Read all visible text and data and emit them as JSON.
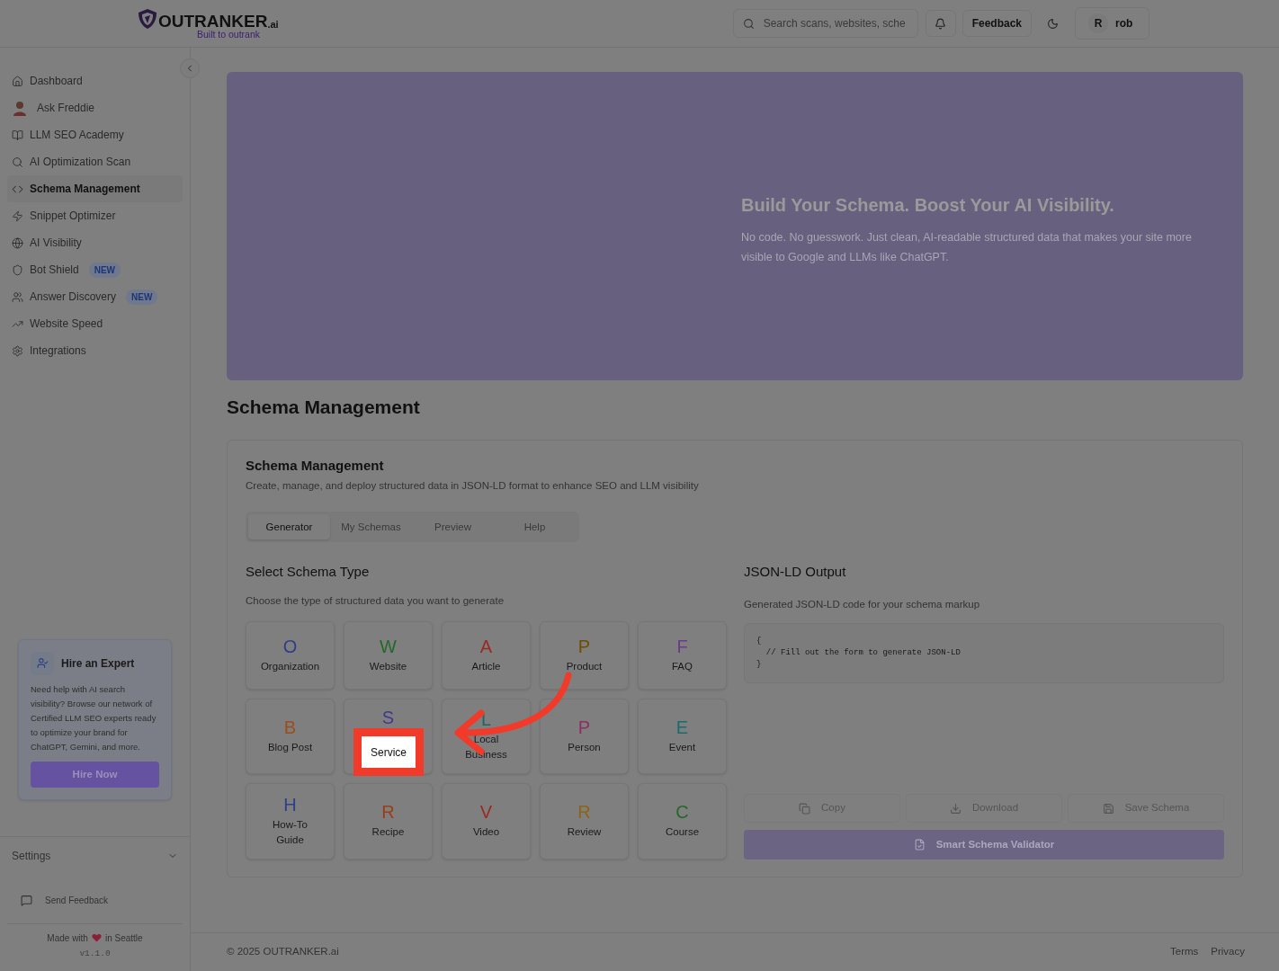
{
  "header": {
    "logo": {
      "name": "OUTRANKER",
      "suffix": ".ai",
      "tagline": "Built to outrank"
    },
    "search": {
      "placeholder": "Search scans, websites, sche"
    },
    "feedback_button": "Feedback",
    "user": {
      "initial": "R",
      "name": "rob"
    }
  },
  "sidebar": {
    "items": [
      {
        "label": "Dashboard",
        "selected": false,
        "kind": "icon"
      },
      {
        "label": "Ask Freddie",
        "selected": false,
        "kind": "avatar"
      },
      {
        "label": "LLM SEO Academy",
        "selected": false,
        "kind": "icon"
      },
      {
        "label": "AI Optimization Scan",
        "selected": false,
        "kind": "icon"
      },
      {
        "label": "Schema Management",
        "selected": true,
        "kind": "icon"
      },
      {
        "label": "Snippet Optimizer",
        "selected": false,
        "kind": "icon"
      },
      {
        "label": "AI Visibility",
        "selected": false,
        "kind": "icon"
      },
      {
        "label": "Bot Shield",
        "selected": false,
        "kind": "icon",
        "badge": "NEW"
      },
      {
        "label": "Answer Discovery",
        "selected": false,
        "kind": "icon",
        "badge": "NEW"
      },
      {
        "label": "Website Speed",
        "selected": false,
        "kind": "icon"
      },
      {
        "label": "Integrations",
        "selected": false,
        "kind": "icon"
      }
    ],
    "hire_card": {
      "title": "Hire an Expert",
      "text": "Need help with AI search visibility? Browse our network of Certified LLM SEO experts ready to optimize your brand for ChatGPT, Gemini, and more.",
      "button": "Hire Now"
    },
    "settings": {
      "label": "Settings",
      "expanded": false
    },
    "send_feedback": "Send Feedback",
    "made_with": {
      "before": "Made with",
      "after": "in Seattle",
      "version": "v1.1.0"
    }
  },
  "banner": {
    "title": "Build Your Schema. Boost Your AI Visibility.",
    "subtitle": "No code. No guesswork. Just clean, AI-readable structured data that makes your site more visible to Google and LLMs like ChatGPT."
  },
  "page_title": "Schema Management",
  "panel": {
    "title": "Schema Management",
    "description": "Create, manage, and deploy structured data in JSON-LD format to enhance SEO and LLM visibility",
    "tabs": [
      {
        "label": "Generator",
        "selected": true
      },
      {
        "label": "My Schemas",
        "selected": false
      },
      {
        "label": "Preview",
        "selected": false
      },
      {
        "label": "Help",
        "selected": false
      }
    ],
    "schema_types": {
      "title": "Select Schema Type",
      "description": "Choose the type of structured data you want to generate",
      "items": [
        {
          "letter": "O",
          "label": "Organization",
          "color": "#2f3f86",
          "highlighted": false
        },
        {
          "letter": "W",
          "label": "Website",
          "color": "#24682a",
          "highlighted": false
        },
        {
          "letter": "A",
          "label": "Article",
          "color": "#9a2a22",
          "highlighted": false
        },
        {
          "letter": "P",
          "label": "Product",
          "color": "#6b4e00",
          "highlighted": false
        },
        {
          "letter": "F",
          "label": "FAQ",
          "color": "#6a3a8c",
          "highlighted": false
        },
        {
          "letter": "B",
          "label": "Blog Post",
          "color": "#9a4e1c",
          "highlighted": false
        },
        {
          "letter": "S",
          "label": "Service",
          "color": "#3f3a8c",
          "highlighted": true
        },
        {
          "letter": "L",
          "label": "Local Business",
          "color": "#1a6a62",
          "highlighted": false
        },
        {
          "letter": "P",
          "label": "Person",
          "color": "#8c2e5e",
          "highlighted": false
        },
        {
          "letter": "E",
          "label": "Event",
          "color": "#1a6a70",
          "highlighted": false
        },
        {
          "letter": "H",
          "label": "How-To Guide",
          "color": "#2f3f86",
          "highlighted": false
        },
        {
          "letter": "R",
          "label": "Recipe",
          "color": "#983e1a",
          "highlighted": false
        },
        {
          "letter": "V",
          "label": "Video",
          "color": "#9a2a22",
          "highlighted": false
        },
        {
          "letter": "R",
          "label": "Review",
          "color": "#8c6418",
          "highlighted": false
        },
        {
          "letter": "C",
          "label": "Course",
          "color": "#24682a",
          "highlighted": false
        }
      ]
    },
    "output": {
      "title": "JSON-LD Output",
      "description": "Generated JSON-LD code for your schema markup",
      "code": [
        "{",
        "  // Fill out the form to generate JSON-LD",
        "}"
      ],
      "buttons": [
        "Copy",
        "Download",
        "Save Schema"
      ],
      "validator": "Smart Schema Validator"
    }
  },
  "footer": {
    "copyright": "© 2025 OUTRANKER.ai",
    "links": [
      "Terms",
      "Privacy"
    ]
  }
}
